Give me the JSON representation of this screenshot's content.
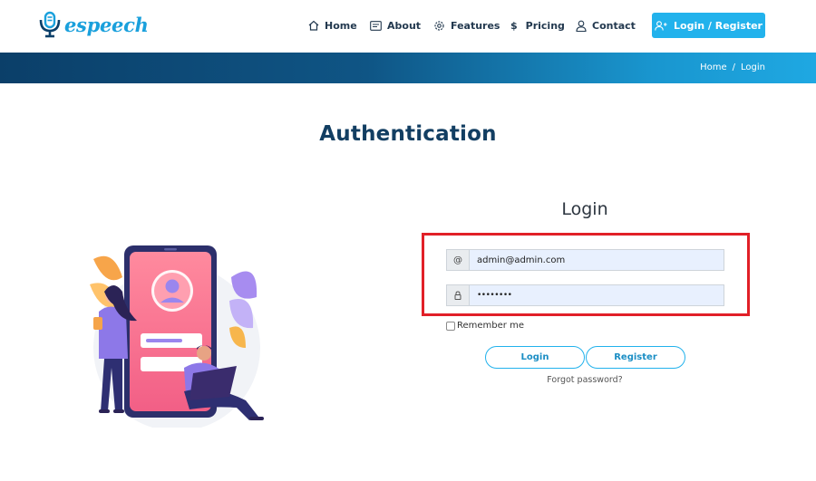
{
  "brand": {
    "name": "espeech"
  },
  "nav": {
    "items": [
      {
        "label": "Home",
        "icon": "home-icon"
      },
      {
        "label": "About",
        "icon": "document-icon"
      },
      {
        "label": "Features",
        "icon": "gear-icon"
      },
      {
        "label": "Pricing",
        "icon": "dollar-icon"
      },
      {
        "label": "Contact",
        "icon": "person-icon"
      }
    ],
    "login_register": "Login / Register"
  },
  "breadcrumb": {
    "home": "Home",
    "separator": "/",
    "current": "Login"
  },
  "page": {
    "title": "Authentication"
  },
  "login_form": {
    "title": "Login",
    "email_addon": "@",
    "email_value": "admin@admin.com",
    "password_value": "••••••••",
    "remember_label": "Remember me",
    "remember_checked": false,
    "login_button": "Login",
    "register_button": "Register",
    "forgot_link": "Forgot password?"
  },
  "colors": {
    "accent": "#22b2ec",
    "title": "#123e62",
    "banner_start": "#0b3f69",
    "banner_end": "#1fa8e2",
    "highlight_border": "#e12028",
    "input_fill": "#e8f0fe"
  }
}
